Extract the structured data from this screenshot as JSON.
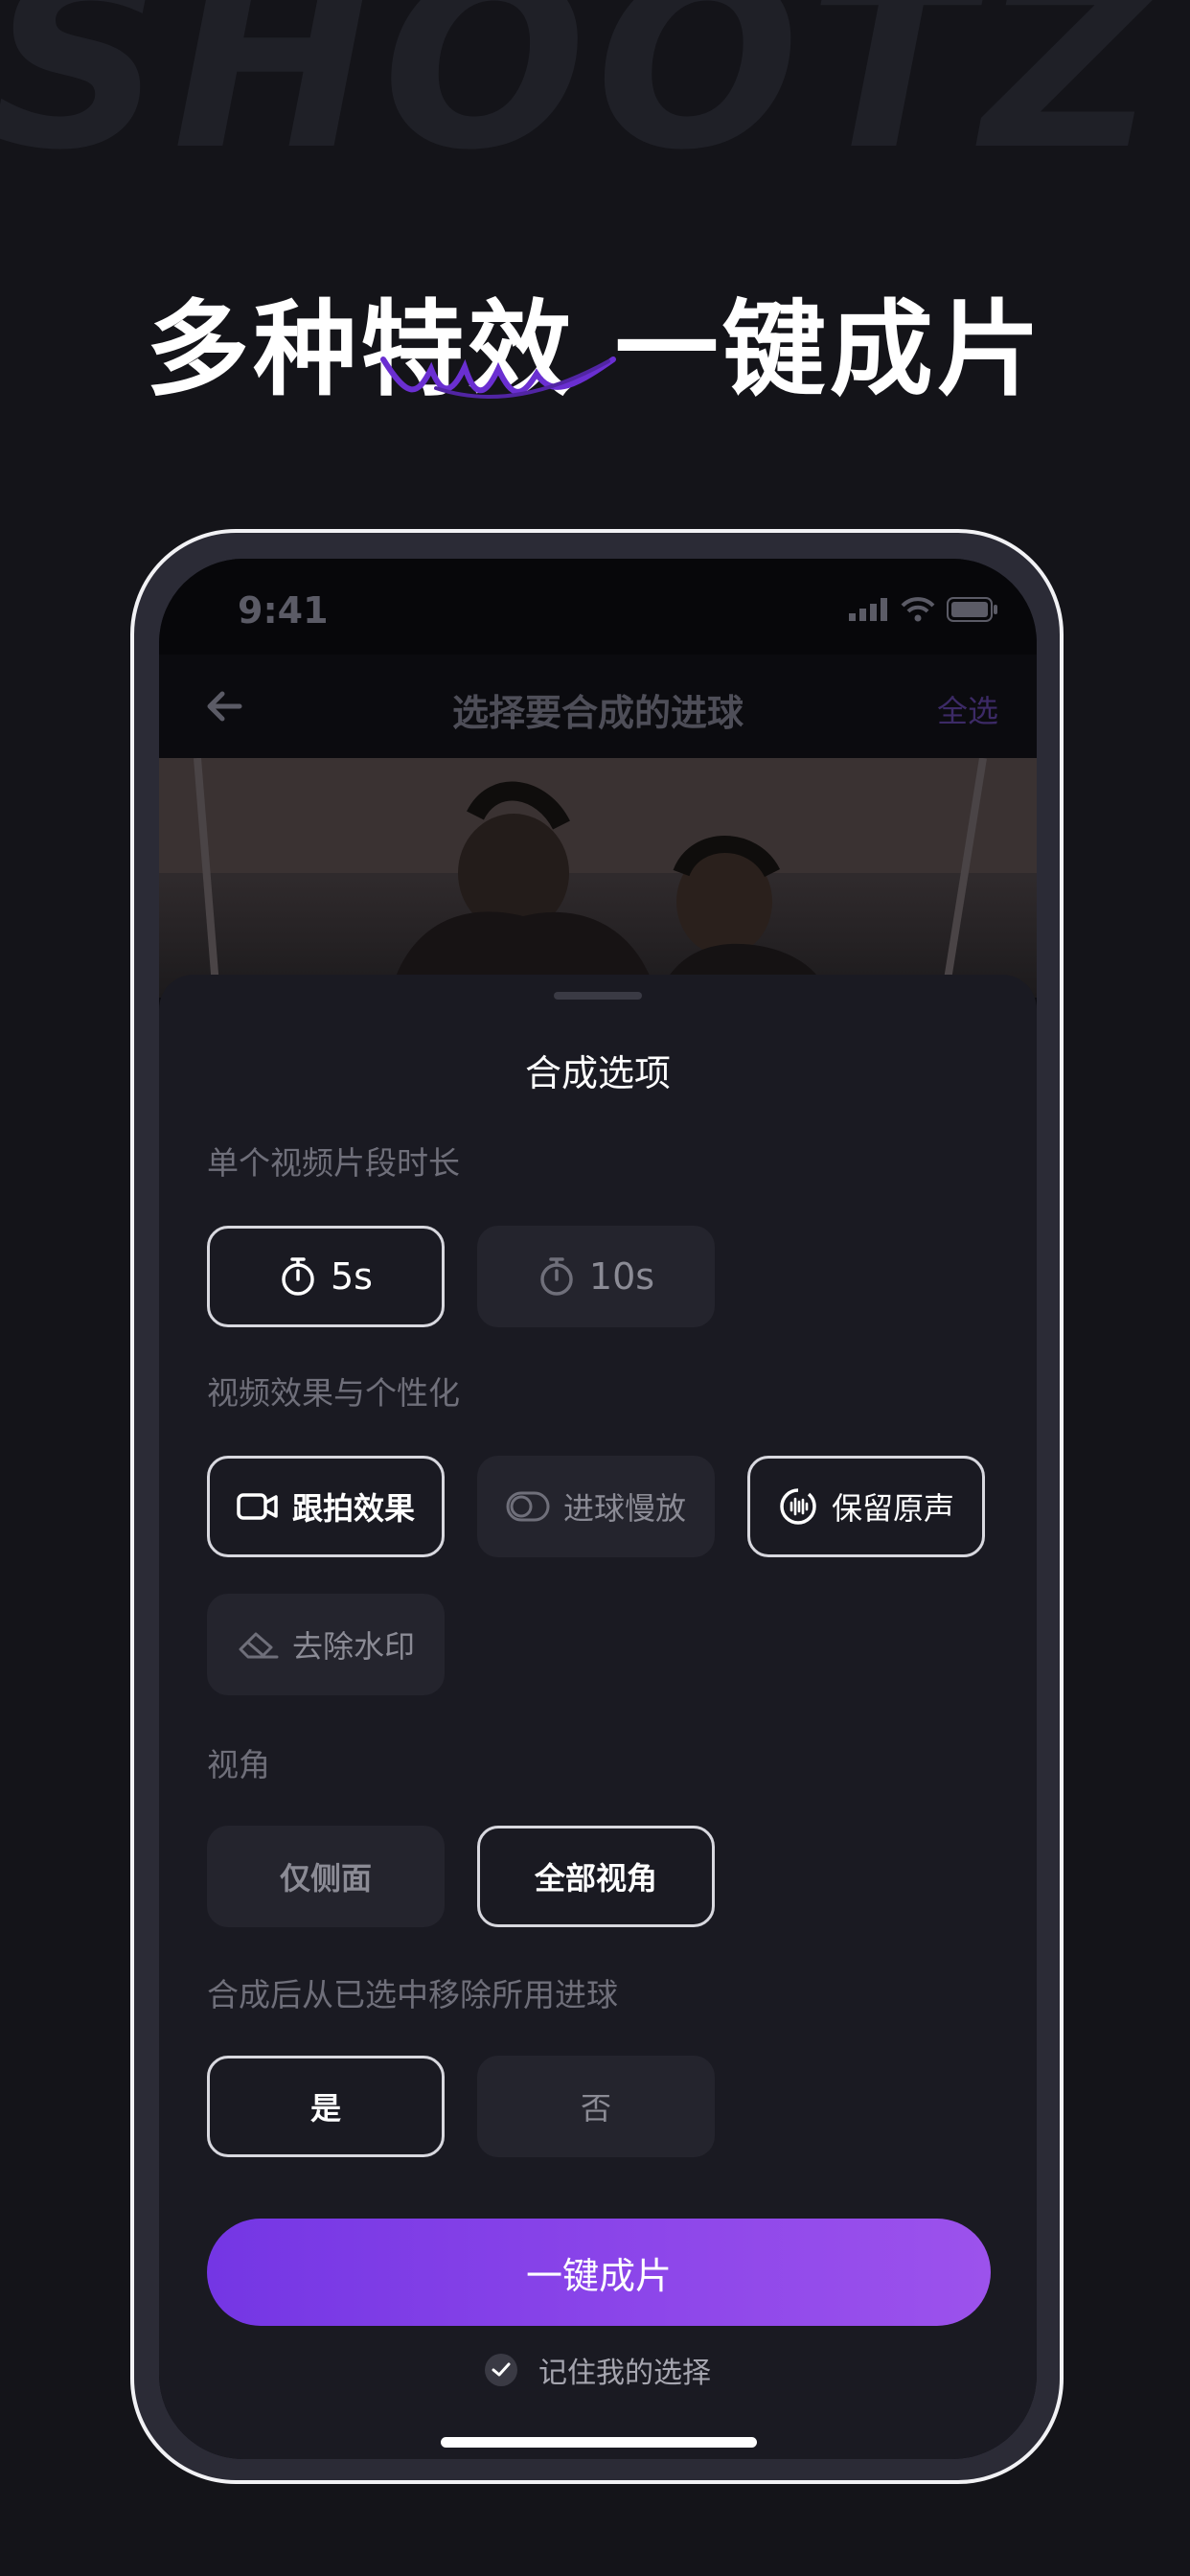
{
  "brand": {
    "word": "SHOOTZ"
  },
  "headline": "多种特效 一键成片",
  "status": {
    "time": "9:41"
  },
  "nav": {
    "title": "选择要合成的进球",
    "right": "全选"
  },
  "sheet": {
    "title": "合成选项",
    "duration": {
      "label": "单个视频片段时长",
      "options": [
        "5s",
        "10s"
      ],
      "selected": "5s"
    },
    "effects": {
      "label": "视频效果与个性化",
      "options": [
        {
          "label": "跟拍效果",
          "icon": "camera-icon",
          "selected": true
        },
        {
          "label": "进球慢放",
          "icon": "toggle-icon",
          "selected": false
        },
        {
          "label": "保留原声",
          "icon": "sound-icon",
          "selected": true
        },
        {
          "label": "去除水印",
          "icon": "eraser-icon",
          "selected": false
        }
      ]
    },
    "view": {
      "label": "视角",
      "options": [
        "仅侧面",
        "全部视角"
      ],
      "selected": "全部视角"
    },
    "remove": {
      "label": "合成后从已选中移除所用进球",
      "options": [
        "是",
        "否"
      ],
      "selected": "是"
    },
    "cta": "一键成片",
    "remember": "记住我的选择"
  },
  "colors": {
    "accent": "#7d3de6",
    "background": "#141419",
    "sheet": "#1a1a22"
  }
}
